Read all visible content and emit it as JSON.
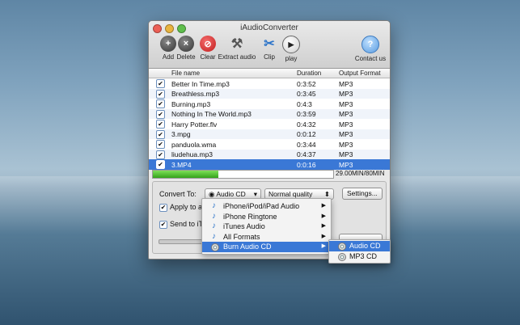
{
  "window": {
    "title": "iAudioConverter"
  },
  "toolbar": {
    "add": "Add",
    "delete": "Delete",
    "clear": "Clear",
    "extract": "Extract audio",
    "clip": "Clip",
    "play": "play",
    "contact": "Contact us"
  },
  "table": {
    "columns": [
      "File name",
      "Duration",
      "Output Format"
    ],
    "rows": [
      {
        "name": "Better In Time.mp3",
        "duration": "0:3:52",
        "format": "MP3"
      },
      {
        "name": "Breathless.mp3",
        "duration": "0:3:45",
        "format": "MP3"
      },
      {
        "name": "Burning.mp3",
        "duration": "0:4:3",
        "format": "MP3"
      },
      {
        "name": "Nothing In The World.mp3",
        "duration": "0:3:59",
        "format": "MP3"
      },
      {
        "name": "Harry Potter.flv",
        "duration": "0:4:32",
        "format": "MP3"
      },
      {
        "name": "3.mpg",
        "duration": "0:0:12",
        "format": "MP3"
      },
      {
        "name": "panduola.wma",
        "duration": "0:3:44",
        "format": "MP3"
      },
      {
        "name": "liudehua.mp3",
        "duration": "0:4:37",
        "format": "MP3"
      },
      {
        "name": "3.MP4",
        "duration": "0:0:16",
        "format": "MP3"
      }
    ]
  },
  "progress": {
    "fraction": 0.3625,
    "label": "29.00MIN/80MIN"
  },
  "convert": {
    "label": "Convert To:",
    "selected": "Audio CD",
    "quality": "Normal quality",
    "settings": "Settings...",
    "apply_all": "Apply to al",
    "send_itunes": "Send to iTu"
  },
  "menu": {
    "items": [
      "iPhone/iPod/iPad Audio",
      "iPhone Ringtone",
      "iTunes Audio",
      "All Formats",
      "Burn Audio CD"
    ],
    "submenu": [
      "Audio CD",
      "MP3 CD"
    ]
  },
  "colors": {
    "selection": "#3a78d6",
    "progress": "#35a31a"
  }
}
